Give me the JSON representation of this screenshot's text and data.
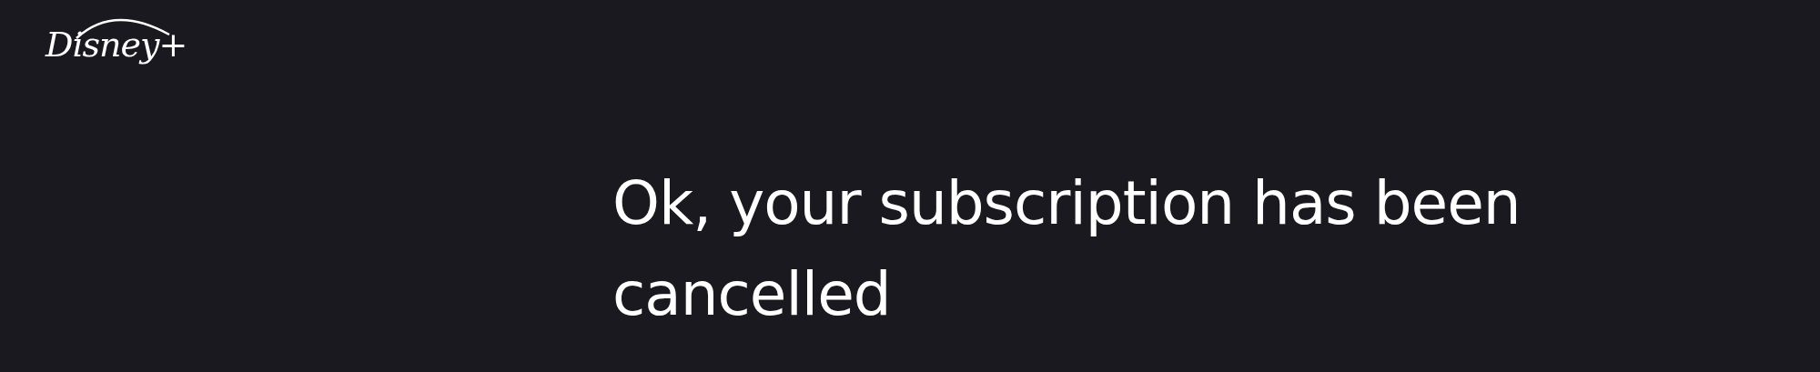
{
  "header": {
    "logo": "Disney+"
  },
  "heading": "Ok, your subscription has been cancelled"
}
